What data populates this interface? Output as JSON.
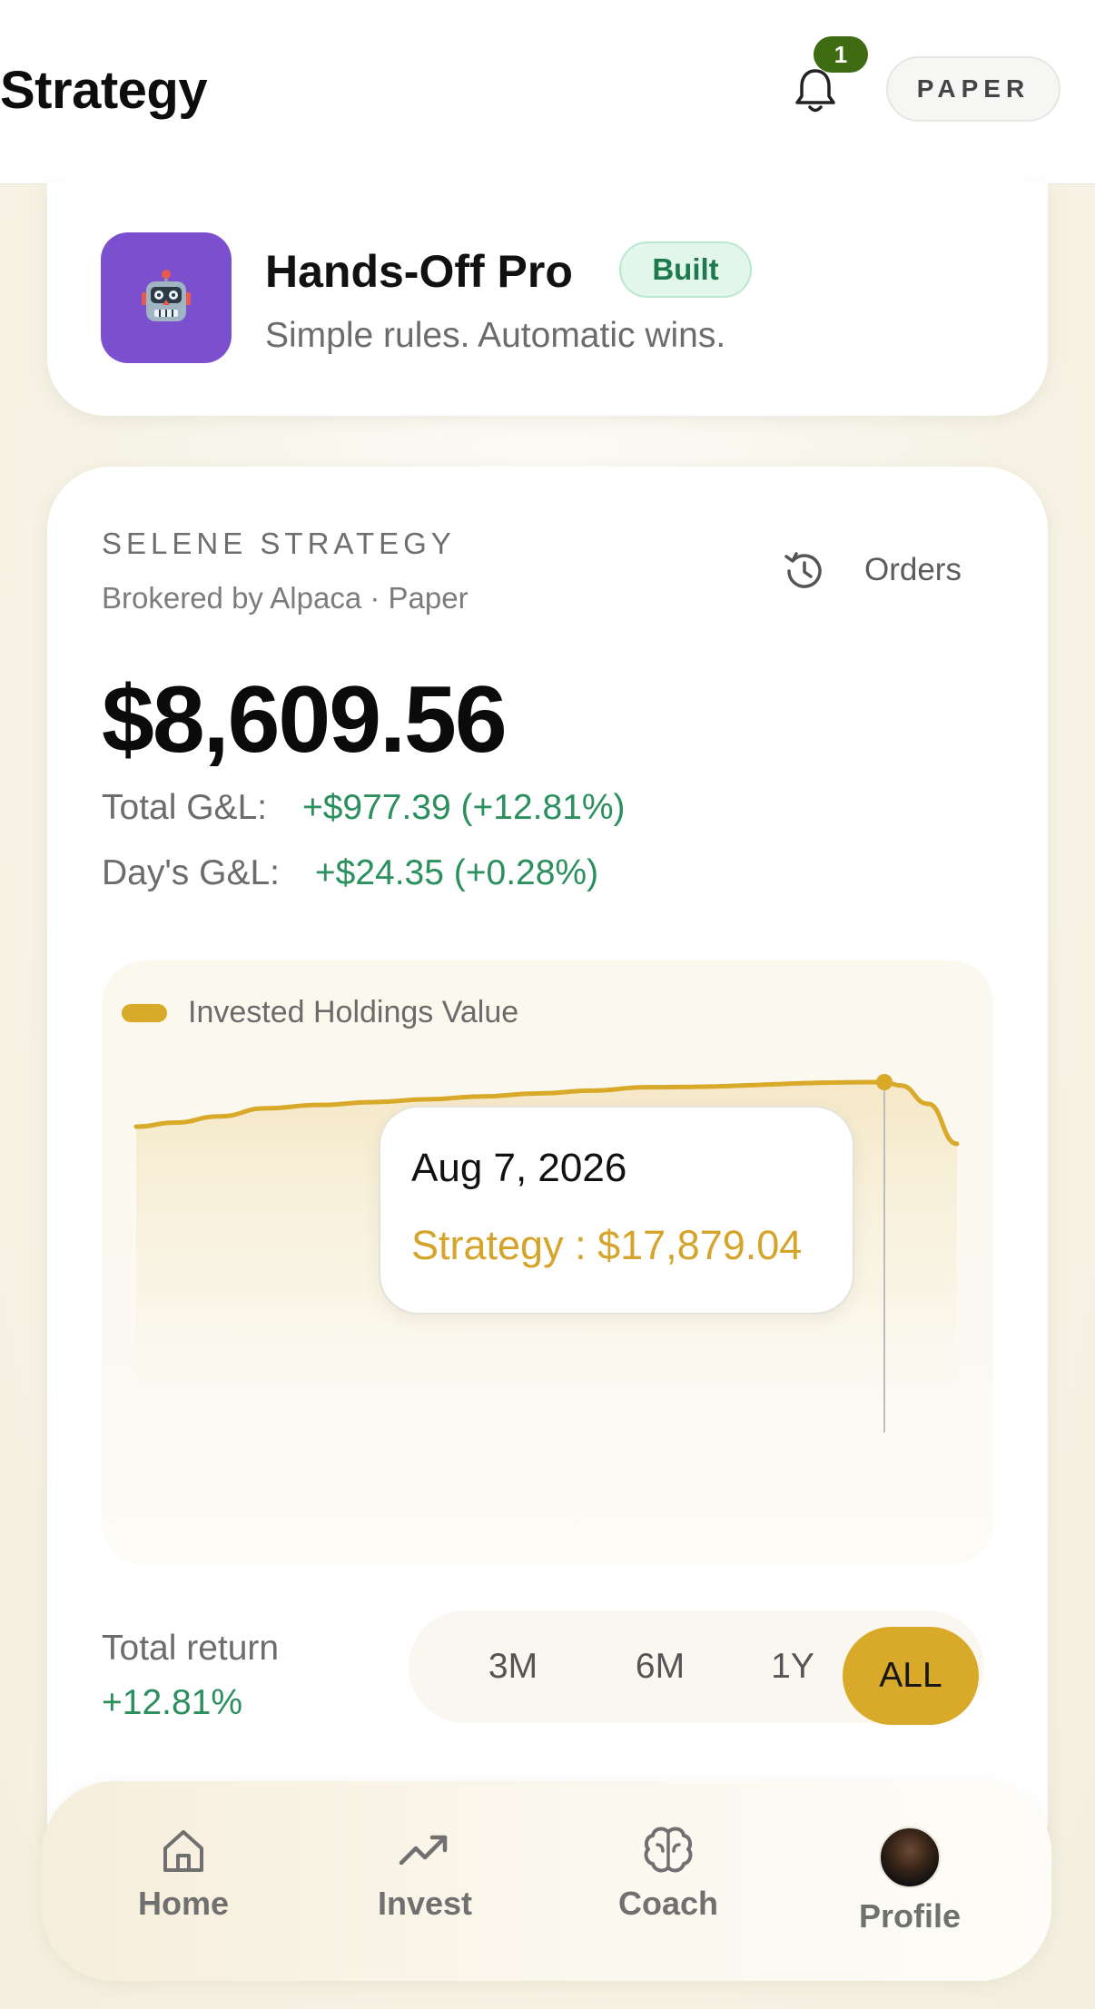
{
  "header": {
    "title": "Strategy",
    "notification_count": "1",
    "mode_pill": "PAPER"
  },
  "strategy_card": {
    "name": "Hands-Off Pro",
    "badge": "Built",
    "tagline": "Simple rules. Automatic wins.",
    "icon": "robot-emoji",
    "icon_bg": "#7c4fce"
  },
  "account": {
    "section_label": "SELENE STRATEGY",
    "broker_line": "Brokered by Alpaca · Paper",
    "orders_label": "Orders",
    "balance": "$8,609.56",
    "total_gl_label": "Total G&L:",
    "total_gl_value": "+$977.39 (+12.81%)",
    "day_gl_label": "Day's G&L:",
    "day_gl_value": "+$24.35 (+0.28%)"
  },
  "chart": {
    "legend": "Invested Holdings Value",
    "tooltip_date": "Aug 7, 2026",
    "tooltip_value": "Strategy : $17,879.04"
  },
  "chart_data": {
    "type": "area",
    "series": [
      {
        "name": "Invested Holdings Value",
        "values": [
          17100,
          17170,
          17280,
          17420,
          17480,
          17530,
          17580,
          17630,
          17680,
          17730,
          17790,
          17879.04,
          17820,
          17500,
          16800
        ]
      }
    ],
    "highlight_index": 11,
    "ylim": [
      15000,
      18000
    ],
    "grid": false,
    "legend_position": "top-left"
  },
  "returns": {
    "label": "Total return",
    "value": "+12.81%",
    "ranges": [
      "3M",
      "6M",
      "1Y",
      "ALL"
    ],
    "selected_range": "ALL"
  },
  "nav": {
    "items": [
      {
        "label": "Home",
        "icon": "home-icon"
      },
      {
        "label": "Invest",
        "icon": "trending-up-icon"
      },
      {
        "label": "Coach",
        "icon": "brain-icon"
      },
      {
        "label": "Profile",
        "icon": "avatar"
      }
    ]
  },
  "colors": {
    "accent": "#d9a929",
    "positive": "#2b8f5e",
    "badge_green": "#3f6b12"
  }
}
